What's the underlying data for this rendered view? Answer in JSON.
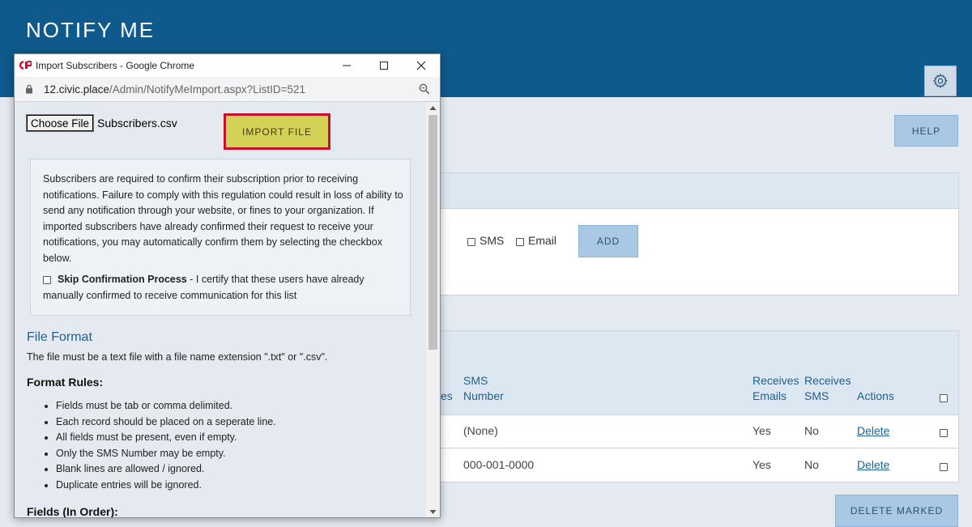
{
  "header": {
    "title": "NOTIFY ME"
  },
  "help_button": "HELP",
  "add_form": {
    "sms_label": "SMS",
    "email_label": "Email",
    "add_label": "ADD"
  },
  "table": {
    "columns": {
      "sms_number_line1": "SMS",
      "sms_number_line2": "Number",
      "prev_col_fragment": "ces",
      "receives_emails_line1": "Receives",
      "receives_emails_line2": "Emails",
      "receives_sms_line1": "Receives",
      "receives_sms_line2": "SMS",
      "actions": "Actions"
    },
    "rows": [
      {
        "sms_number": "(None)",
        "receives_emails": "Yes",
        "receives_sms": "No",
        "action": "Delete"
      },
      {
        "sms_number": "000-001-0000",
        "receives_emails": "Yes",
        "receives_sms": "No",
        "action": "Delete"
      }
    ]
  },
  "delete_marked": "DELETE MARKED",
  "popup": {
    "window_title": "Import Subscribers - Google Chrome",
    "url_host": "12.civic.place",
    "url_path": "/Admin/NotifyMeImport.aspx?ListID=521",
    "choose_file": "Choose File",
    "file_name": "Subscribers.csv",
    "import_button": "IMPORT FILE",
    "notice": "Subscribers are required to confirm their subscription prior to receiving notifications. Failure to comply with this regulation could result in loss of ability to send any notification through your website, or fines to your organization. If imported subscribers have already confirmed their request to receive your notifications, you may automatically confirm them by selecting the checkbox below.",
    "skip_label": "Skip Confirmation Process",
    "skip_text": " - I certify that these users have already manually confirmed to receive communication for this list",
    "file_format_title": "File Format",
    "file_format_desc": "The file must be a text file with a file name extension \".txt\" or \".csv\".",
    "format_rules_title": "Format Rules:",
    "rules": [
      "Fields must be tab or comma delimited.",
      "Each record should be placed on a seperate line.",
      "All fields must be present, even if empty.",
      "Only the SMS Number may be empty.",
      "Blank lines are allowed / ignored.",
      "Duplicate entries will be ignored."
    ],
    "fields_title": "Fields (In Order):"
  },
  "colors": {
    "header_bg": "#0f5a8c",
    "button_bg": "#a8c8e4",
    "import_bg": "#d4d157",
    "highlight_border": "#c8102e",
    "link": "#1f5f8f"
  }
}
